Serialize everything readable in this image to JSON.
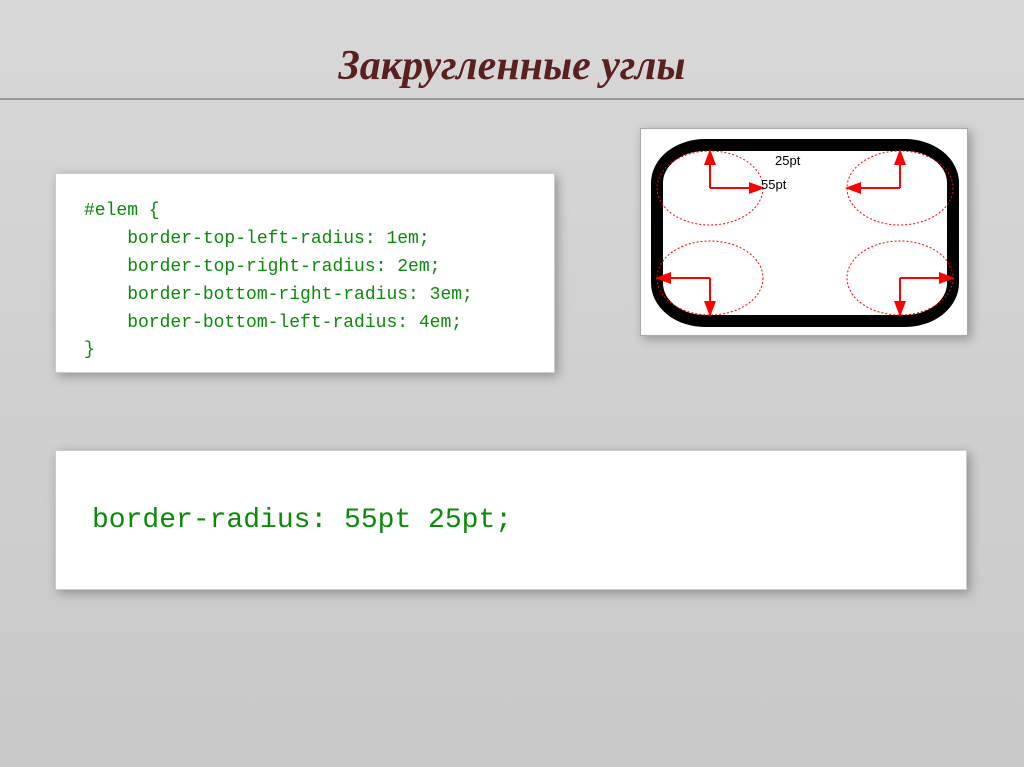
{
  "title": "Закругленные углы",
  "code1": "#elem {\n    border-top-left-radius: 1em;\n    border-top-right-radius: 2em;\n    border-bottom-right-radius: 3em;\n    border-bottom-left-radius: 4em;\n}",
  "code2": "border-radius: 55pt 25pt;",
  "diagram": {
    "label1": "25pt",
    "label2": "55pt"
  }
}
